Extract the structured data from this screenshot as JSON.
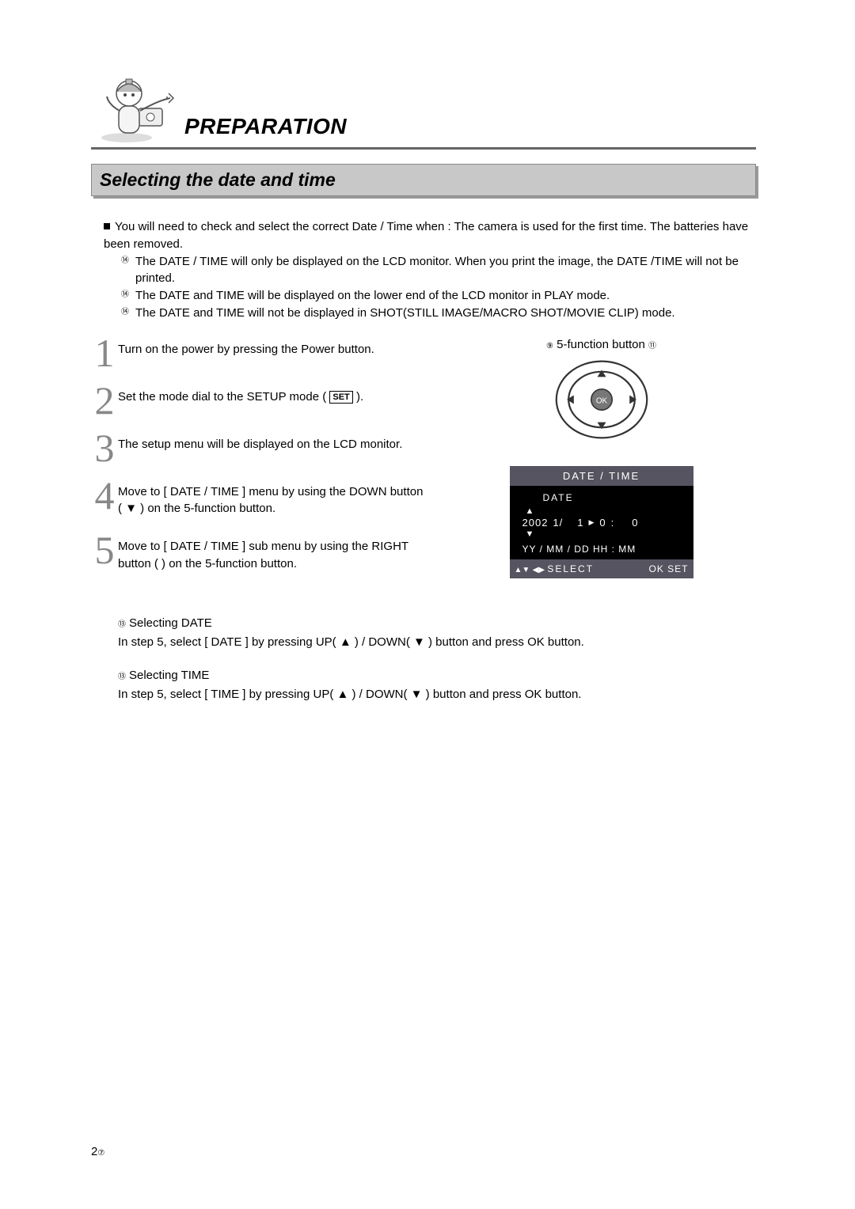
{
  "header": {
    "chapter": "PREPARATION",
    "section": "Selecting the date and time"
  },
  "intro": {
    "lead": "You will need to check and select the correct Date / Time when : The camera is used for the first time. The batteries have been removed.",
    "bullets": [
      "The DATE / TIME will only be displayed on the LCD monitor. When you print the image, the DATE /TIME will not be printed.",
      "The DATE and TIME will be displayed on the lower end of the LCD monitor in PLAY mode.",
      "The DATE and TIME will not be displayed in SHOT(STILL IMAGE/MACRO SHOT/MOVIE CLIP) mode."
    ]
  },
  "steps": [
    "Turn on the power by pressing the Power button.",
    "Set the mode dial to the SETUP mode (",
    "The setup menu will be displayed on the LCD monitor.",
    "Move to [ DATE / TIME ] menu by using the DOWN button ( ▼ ) on the 5-function button.",
    "Move to [ DATE / TIME ] sub menu by using the RIGHT button (    ) on the 5-function button."
  ],
  "set_label": "SET",
  "fivefunc_label": "5-function button",
  "fivefunc_left": "⑨",
  "fivefunc_right": "⑪",
  "lcd": {
    "title": "DATE / TIME",
    "date_label": "DATE",
    "year": "2002",
    "month": "1/",
    "day": "1",
    "hour": "0",
    "min": "0",
    "format": "YY /   MM /   DD       HH   :   MM",
    "select": "SELECT",
    "okset": "OK SET"
  },
  "notes": {
    "date_head": "Selecting DATE",
    "date_body": "In step 5, select [ DATE ] by pressing UP( ▲ ) / DOWN( ▼ ) button and press OK button.",
    "time_head": "Selecting TIME",
    "time_body": "In step 5, select [ TIME ] by pressing UP( ▲ ) / DOWN( ▼ ) button and press OK button."
  },
  "note_marker": "⑬",
  "bullet_marker": "⑭",
  "page_number_major": "2",
  "page_number_minor": "⑦"
}
